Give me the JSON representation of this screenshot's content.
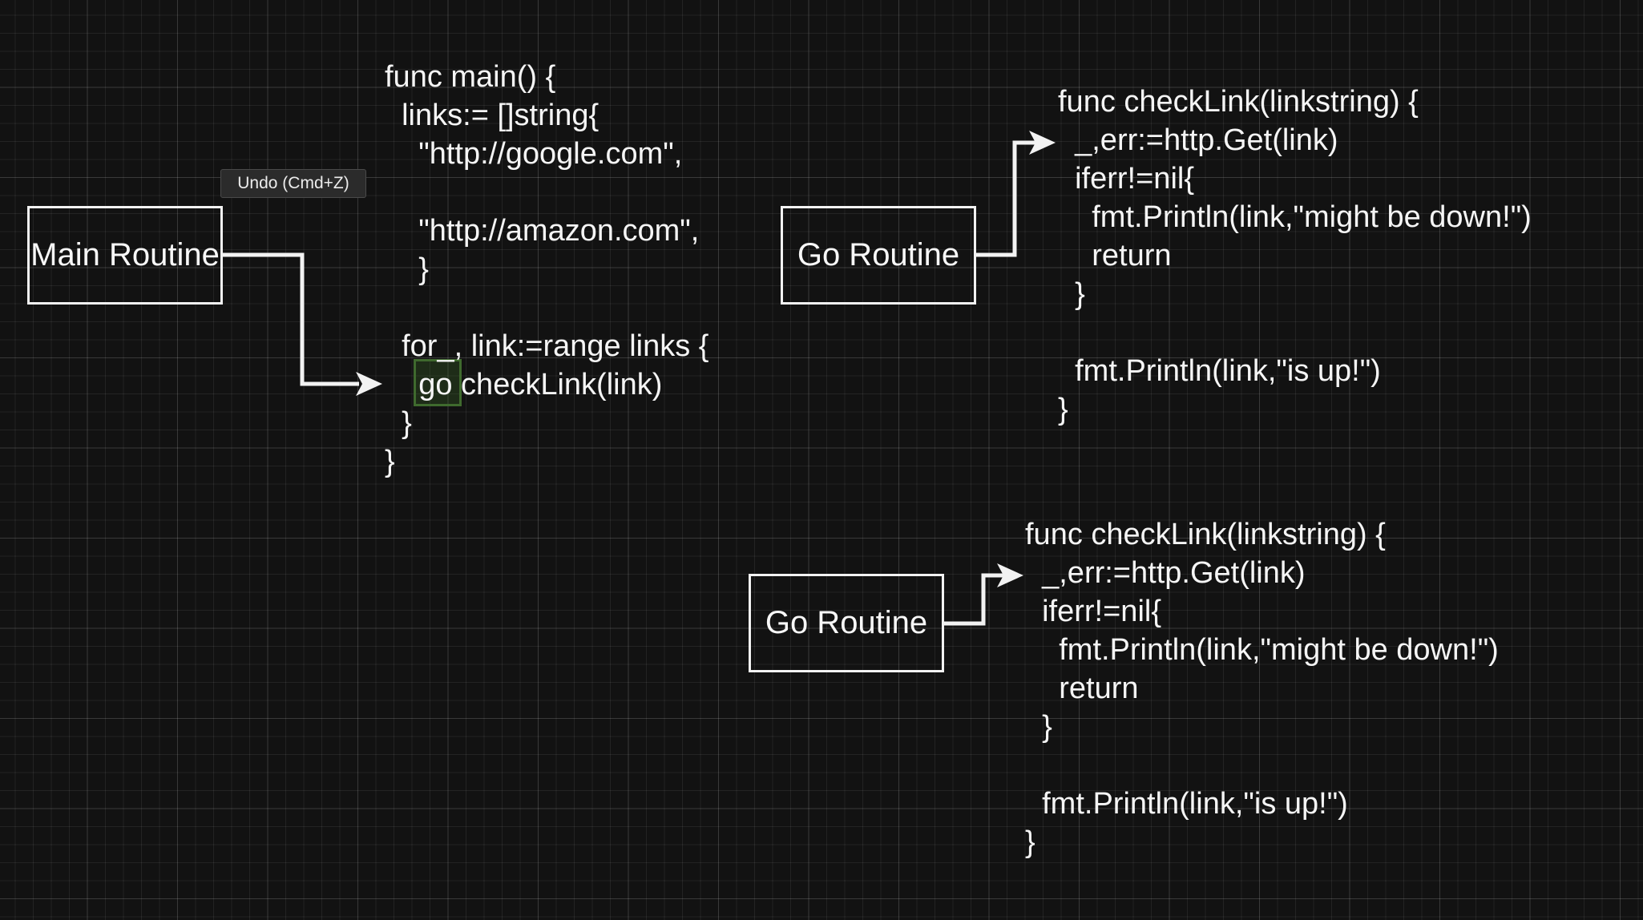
{
  "canvas": {
    "background_color": "#121212",
    "stroke_color": "#f2f2f2",
    "highlight_color": "#3f6a2e"
  },
  "tooltip": {
    "text": "Undo (Cmd+Z)"
  },
  "boxes": {
    "main_routine": "Main Routine",
    "go_routine_top": "Go Routine",
    "go_routine_bottom": "Go Routine"
  },
  "main_code": {
    "lines": [
      "func main() {",
      "  links:= []string{",
      "    \"http://google.com\",",
      "",
      "    \"http://amazon.com\",",
      "    }",
      "",
      "  for_, link:=range links {",
      "    go checkLink(link)",
      "  }",
      "}"
    ]
  },
  "check_link_top": {
    "lines": [
      "func checkLink(linkstring) {",
      "  _,err:=http.Get(link)",
      "  iferr!=nil{",
      "    fmt.Println(link,\"might be down!\")",
      "    return",
      "  }",
      "",
      "  fmt.Println(link,\"is up!\")",
      "}"
    ]
  },
  "check_link_bottom": {
    "lines": [
      "func checkLink(linkstring) {",
      "  _,err:=http.Get(link)",
      "  iferr!=nil{",
      "    fmt.Println(link,\"might be down!\")",
      "    return",
      "  }",
      "",
      "  fmt.Println(link,\"is up!\")",
      "}"
    ]
  }
}
